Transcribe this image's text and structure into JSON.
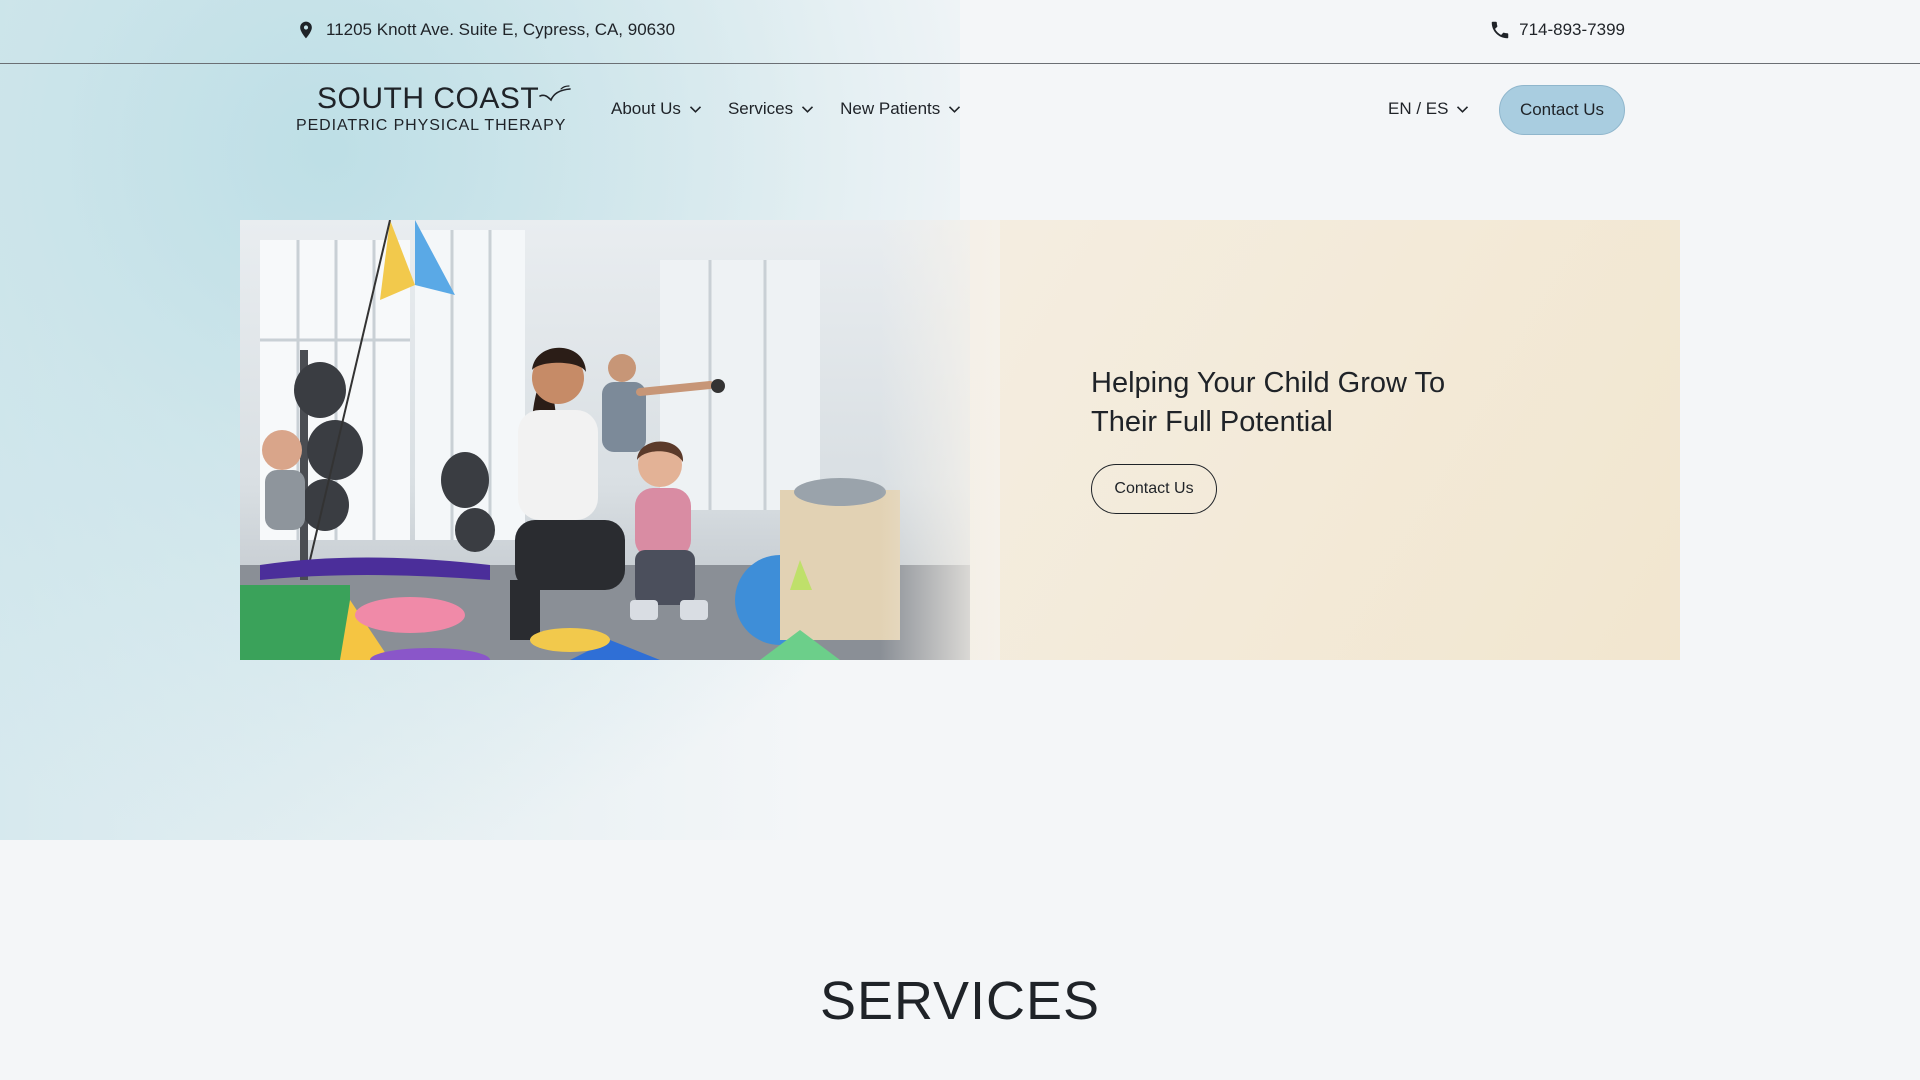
{
  "topbar": {
    "address": "11205 Knott Ave. Suite E, Cypress, CA, 90630",
    "phone": "714-893-7399",
    "address_icon": "location-pin-icon",
    "phone_icon": "phone-icon"
  },
  "logo": {
    "line1": "SOUTH COAST",
    "line2": "PEDIATRIC PHYSICAL THERAPY",
    "icon": "bird-icon"
  },
  "nav": {
    "items": [
      {
        "label": "About Us"
      },
      {
        "label": "Services"
      },
      {
        "label": "New Patients"
      }
    ],
    "language": "EN / ES",
    "contact_label": "Contact Us"
  },
  "hero": {
    "title": "Helping Your Child Grow To Their Full  Potential",
    "cta_label": "Contact Us",
    "image_icon": "therapy-gym-photo"
  },
  "sections": {
    "services_heading": "SERVICES"
  },
  "colors": {
    "accent_button": "#a9cde0",
    "page_bg": "#f4f6f8",
    "hero_bg": "#f4eee2",
    "text": "#1f2328"
  }
}
